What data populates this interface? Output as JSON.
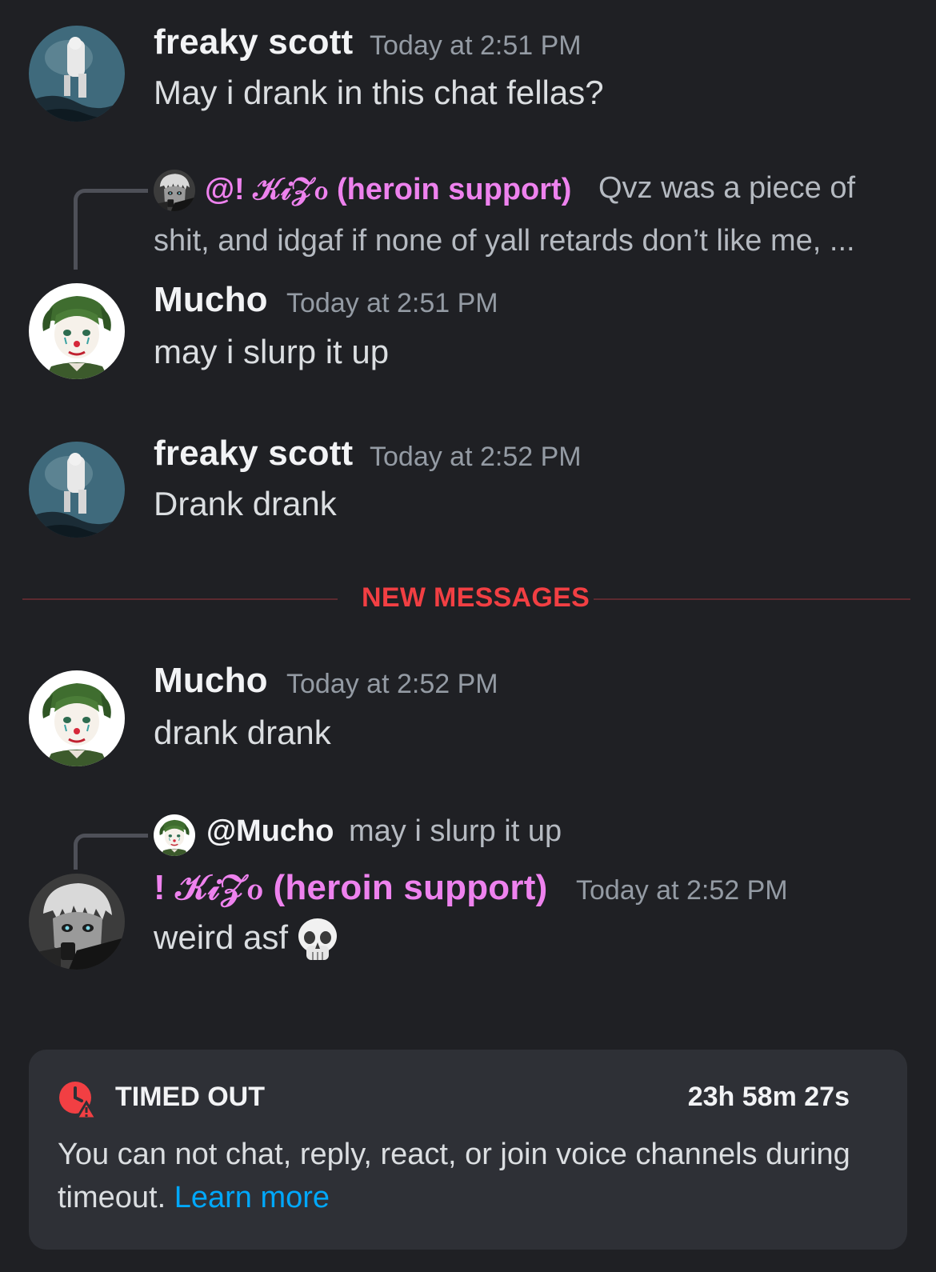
{
  "messages": [
    {
      "author": "freaky scott",
      "time": "Today at 2:51 PM",
      "text": "May i drank in this chat fellas?"
    },
    {
      "reply": {
        "author": "@! 𝒦𝒾𝒵ℴ (heroin support)",
        "text_line1": "Qvz was a piece of",
        "text_line2": "shit, and idgaf if none of yall retards don’t like me, ..."
      },
      "author": "Mucho",
      "time": "Today at 2:51 PM",
      "text": "may i slurp it up"
    },
    {
      "author": "freaky scott",
      "time": "Today at 2:52 PM",
      "text": "Drank drank"
    },
    {
      "author": "Mucho",
      "time": "Today at 2:52 PM",
      "text": "drank drank"
    },
    {
      "reply": {
        "author": "@Mucho",
        "text": "may i slurp it up"
      },
      "author": "! 𝒦𝒾𝒵ℴ (heroin support)",
      "time": "Today at 2:52 PM",
      "text": "weird asf",
      "emoji": "skull-emoji"
    }
  ],
  "divider": {
    "label": "NEW MESSAGES"
  },
  "timeout": {
    "title": "TIMED OUT",
    "countdown": "23h 58m 27s",
    "description": "You can not chat, reply, react, or join voice channels during timeout.",
    "link": "Learn more",
    "icon": "clock-warning-icon"
  },
  "colors": {
    "background": "#1f2024",
    "role_pink": "#ee82ee",
    "new_messages_red": "#f23f43",
    "link_blue": "#00a8fc",
    "banner_bg": "#2e3036"
  }
}
